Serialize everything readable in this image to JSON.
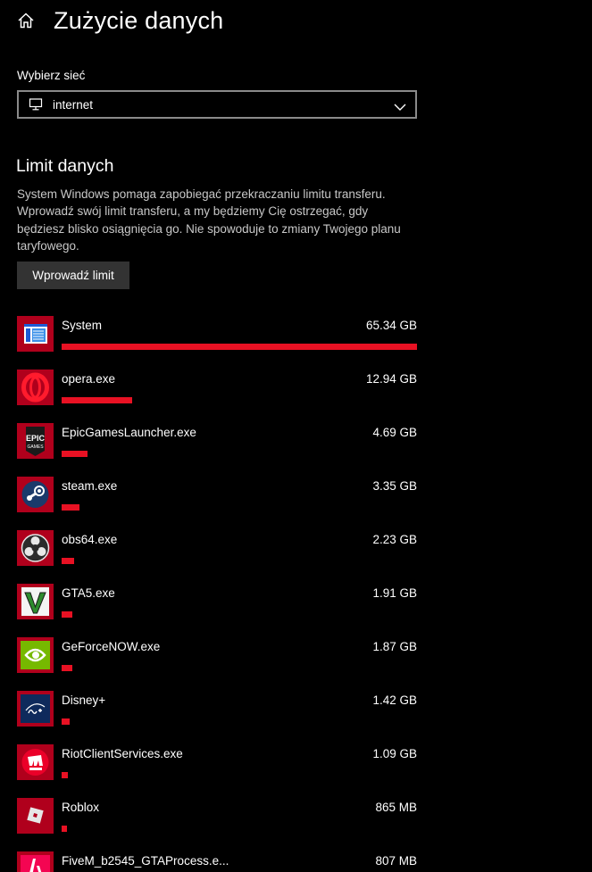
{
  "header": {
    "title": "Zużycie danych",
    "home_icon": "home-icon"
  },
  "network": {
    "label": "Wybierz sieć",
    "selected": "internet",
    "icon": "monitor-icon"
  },
  "data_limit": {
    "title": "Limit danych",
    "description": "System Windows pomaga zapobiegać przekraczaniu limitu transferu. Wprowadź swój limit transferu, a my będziemy Cię ostrzegać, gdy będziesz blisko osiągnięcia go. Nie spowoduje to zmiany Twojego planu taryfowego.",
    "button_label": "Wprowadź limit"
  },
  "colors": {
    "accent": "#e81123",
    "icon_bg": "#b0001c",
    "background": "#000000"
  },
  "apps": [
    {
      "name": "System",
      "usage": "65.34 GB",
      "usage_fraction": 1.0,
      "icon": "system-icon"
    },
    {
      "name": "opera.exe",
      "usage": "12.94 GB",
      "usage_fraction": 0.198,
      "icon": "opera-icon"
    },
    {
      "name": "EpicGamesLauncher.exe",
      "usage": "4.69 GB",
      "usage_fraction": 0.072,
      "icon": "epic-games-icon"
    },
    {
      "name": "steam.exe",
      "usage": "3.35 GB",
      "usage_fraction": 0.051,
      "icon": "steam-icon"
    },
    {
      "name": "obs64.exe",
      "usage": "2.23 GB",
      "usage_fraction": 0.034,
      "icon": "obs-icon"
    },
    {
      "name": "GTA5.exe",
      "usage": "1.91 GB",
      "usage_fraction": 0.029,
      "icon": "gta5-icon"
    },
    {
      "name": "GeForceNOW.exe",
      "usage": "1.87 GB",
      "usage_fraction": 0.029,
      "icon": "nvidia-icon"
    },
    {
      "name": "Disney+",
      "usage": "1.42 GB",
      "usage_fraction": 0.022,
      "icon": "disney-plus-icon"
    },
    {
      "name": "RiotClientServices.exe",
      "usage": "1.09 GB",
      "usage_fraction": 0.017,
      "icon": "riot-icon"
    },
    {
      "name": "Roblox",
      "usage": "865 MB",
      "usage_fraction": 0.013,
      "icon": "roblox-icon"
    },
    {
      "name": "FiveM_b2545_GTAProcess.e...",
      "usage": "807 MB",
      "usage_fraction": 0.012,
      "icon": "fivem-icon"
    }
  ]
}
